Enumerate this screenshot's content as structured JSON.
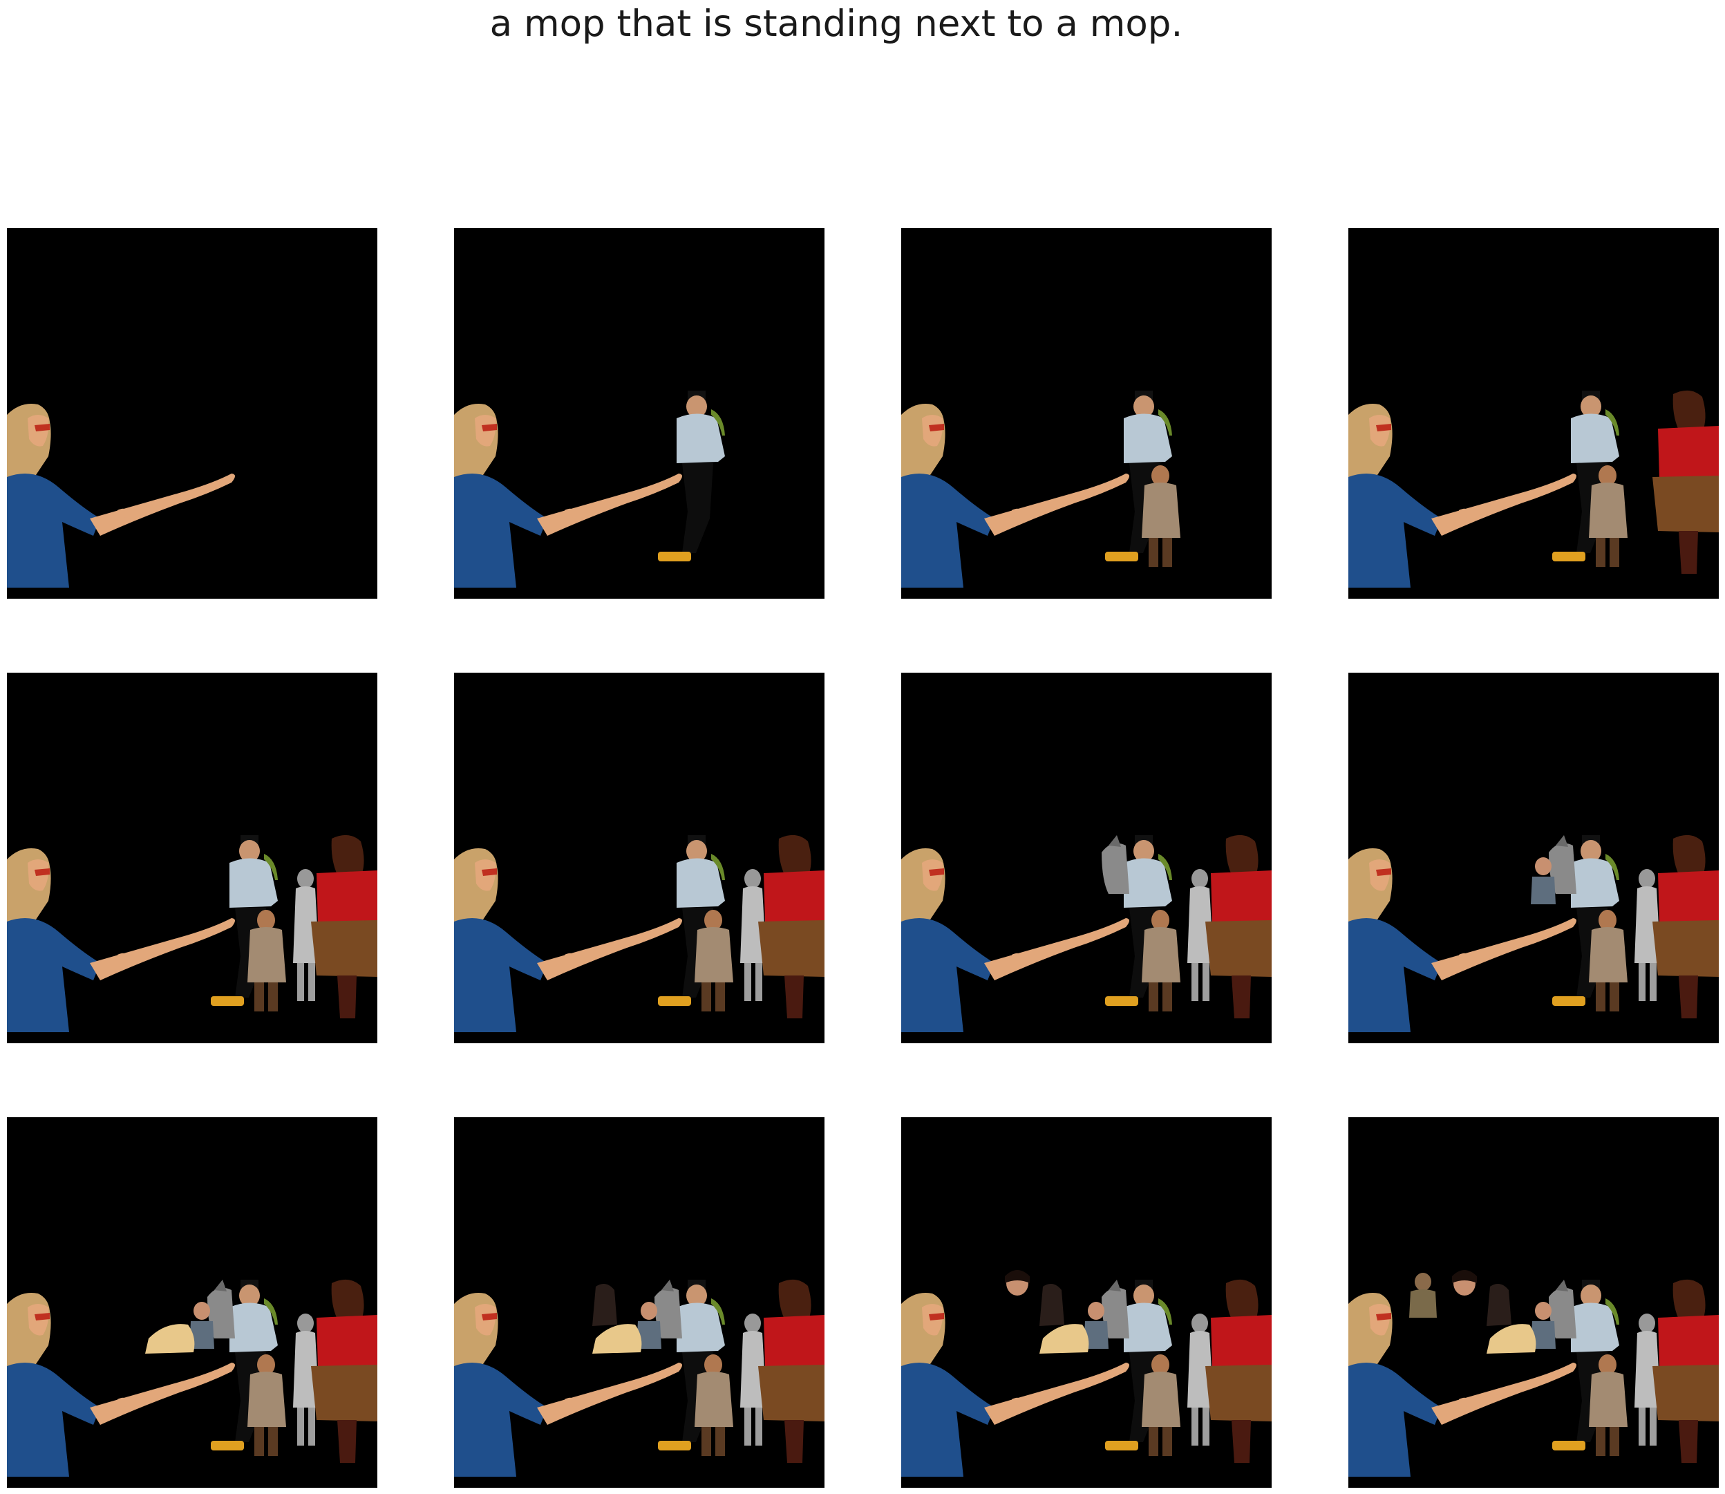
{
  "figure": {
    "title": "a mop that is standing next to a mop."
  },
  "panels": [
    {
      "figures": [
        "woman"
      ]
    },
    {
      "figures": [
        "woman",
        "man"
      ]
    },
    {
      "figures": [
        "woman",
        "man",
        "child"
      ]
    },
    {
      "figures": [
        "woman",
        "man",
        "child",
        "red-shirt-person"
      ]
    },
    {
      "figures": [
        "woman",
        "man",
        "child",
        "grey-girl",
        "red-shirt-person"
      ]
    },
    {
      "figures": [
        "woman",
        "man",
        "child",
        "grey-girl",
        "red-shirt-person"
      ]
    },
    {
      "figures": [
        "woman",
        "man",
        "child",
        "grey-girl",
        "red-shirt-person",
        "horse"
      ]
    },
    {
      "figures": [
        "woman",
        "man",
        "child",
        "grey-girl",
        "red-shirt-person",
        "horse",
        "small-boy"
      ]
    },
    {
      "figures": [
        "woman",
        "man",
        "child",
        "grey-girl",
        "red-shirt-person",
        "horse",
        "small-boy",
        "blanket"
      ]
    },
    {
      "figures": [
        "woman",
        "man",
        "child",
        "grey-girl",
        "red-shirt-person",
        "horse",
        "small-boy",
        "blanket",
        "dark-person"
      ]
    },
    {
      "figures": [
        "woman",
        "man",
        "child",
        "grey-girl",
        "red-shirt-person",
        "horse",
        "small-boy",
        "blanket",
        "dark-person",
        "face"
      ]
    },
    {
      "figures": [
        "woman",
        "man",
        "child",
        "grey-girl",
        "red-shirt-person",
        "horse",
        "small-boy",
        "blanket",
        "dark-person",
        "face",
        "seated-man"
      ]
    }
  ],
  "colors": {
    "background": "#000000",
    "shirt_blue": "#1f4f8c",
    "skin": "#e2a77a",
    "hair": "#c9a26a",
    "shirt_red": "#c0161a",
    "skirt_brown": "#7a4a22",
    "coat_tan": "#a38b72",
    "shirt_lightblue": "#b8c8d4"
  }
}
